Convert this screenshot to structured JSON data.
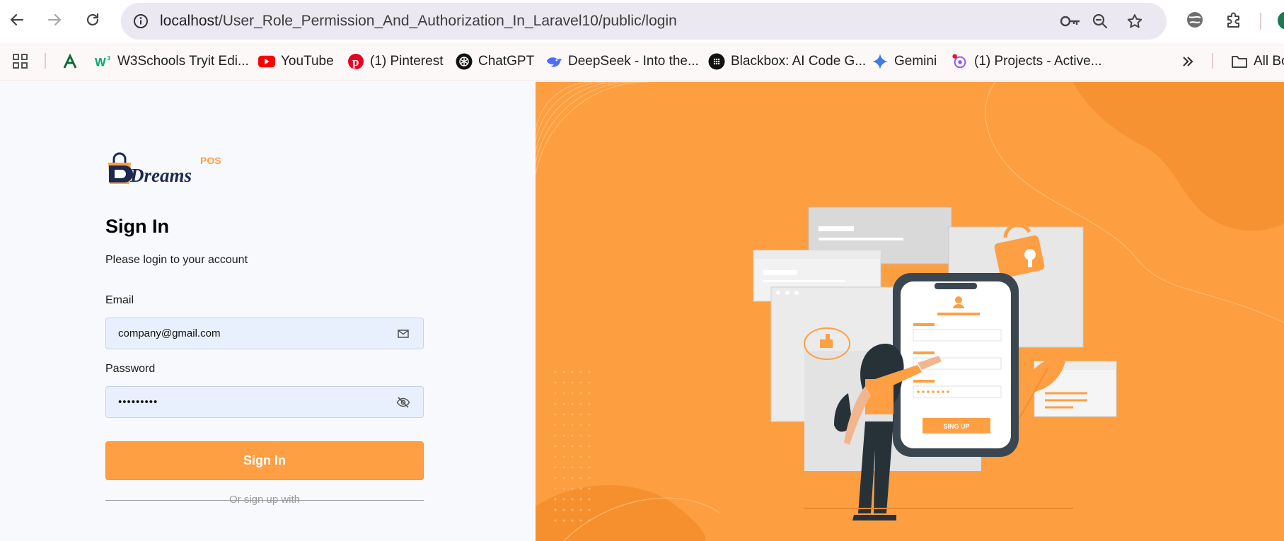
{
  "browser": {
    "url_host": "localhost",
    "url_path": "/User_Role_Permission_And_Authorization_In_Laravel10/public/login",
    "bookmarks": [
      {
        "label": "W3Schools Tryit Edi...",
        "icon": "w3schools-icon"
      },
      {
        "label": "YouTube",
        "icon": "youtube-icon"
      },
      {
        "label": "(1) Pinterest",
        "icon": "pinterest-icon"
      },
      {
        "label": "ChatGPT",
        "icon": "chatgpt-icon"
      },
      {
        "label": "DeepSeek - Into the...",
        "icon": "deepseek-icon"
      },
      {
        "label": "Blackbox: AI Code G...",
        "icon": "blackbox-icon"
      },
      {
        "label": "Gemini",
        "icon": "gemini-icon"
      },
      {
        "label": "(1) Projects - Active...",
        "icon": "projects-icon"
      }
    ],
    "all_bookmarks": "All Bo"
  },
  "login": {
    "logo_text": "Dreams",
    "logo_sub": "POS",
    "title": "Sign In",
    "subtitle": "Please login to your account",
    "email_label": "Email",
    "email_value": "company@gmail.com",
    "password_label": "Password",
    "password_value": "•••••••••",
    "signin_label": "Sign In",
    "divider_text": "Or sign up with"
  },
  "illustration": {
    "button_text": "SING UP"
  },
  "colors": {
    "accent": "#fe9f43",
    "panel_bg": "#fd9f40",
    "navy": "#1b2850"
  }
}
